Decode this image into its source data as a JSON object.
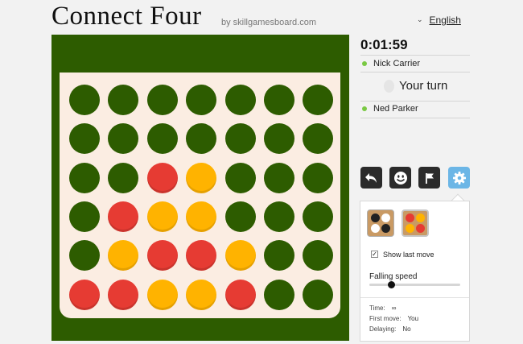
{
  "header": {
    "title": "Connect Four",
    "byline": "by skillgamesboard.com",
    "language": "English"
  },
  "game": {
    "timer": "0:01:59",
    "player_top": "Nick Carrier",
    "player_bottom": "Ned Parker",
    "turn_text": "Your turn",
    "board": [
      [
        "e",
        "e",
        "e",
        "e",
        "e",
        "e",
        "e"
      ],
      [
        "e",
        "e",
        "e",
        "e",
        "e",
        "e",
        "e"
      ],
      [
        "e",
        "e",
        "r",
        "y",
        "e",
        "e",
        "e"
      ],
      [
        "e",
        "r",
        "y",
        "y",
        "e",
        "e",
        "e"
      ],
      [
        "e",
        "y",
        "r",
        "r",
        "y",
        "e",
        "e"
      ],
      [
        "r",
        "r",
        "y",
        "y",
        "r",
        "e",
        "e"
      ]
    ],
    "colors": {
      "board": "#2d5c00",
      "red": "#e63b33",
      "yellow": "#ffb300",
      "inner": "#fbede2"
    }
  },
  "toolbar": {
    "undo_icon": "undo-arrow-icon",
    "chat_icon": "smiley-icon",
    "resign_icon": "flag-icon",
    "settings_icon": "gear-icon"
  },
  "settings": {
    "theme_1": "black-white-theme",
    "theme_2": "red-yellow-theme",
    "show_last_move": "Show last move",
    "show_last_move_checked": true,
    "falling_speed_label": "Falling speed",
    "falling_speed_value": 0.24,
    "time_label": "Time:",
    "time_value": "∞",
    "first_move_label": "First move:",
    "first_move_value": "You",
    "delaying_label": "Delaying:",
    "delaying_value": "No"
  }
}
